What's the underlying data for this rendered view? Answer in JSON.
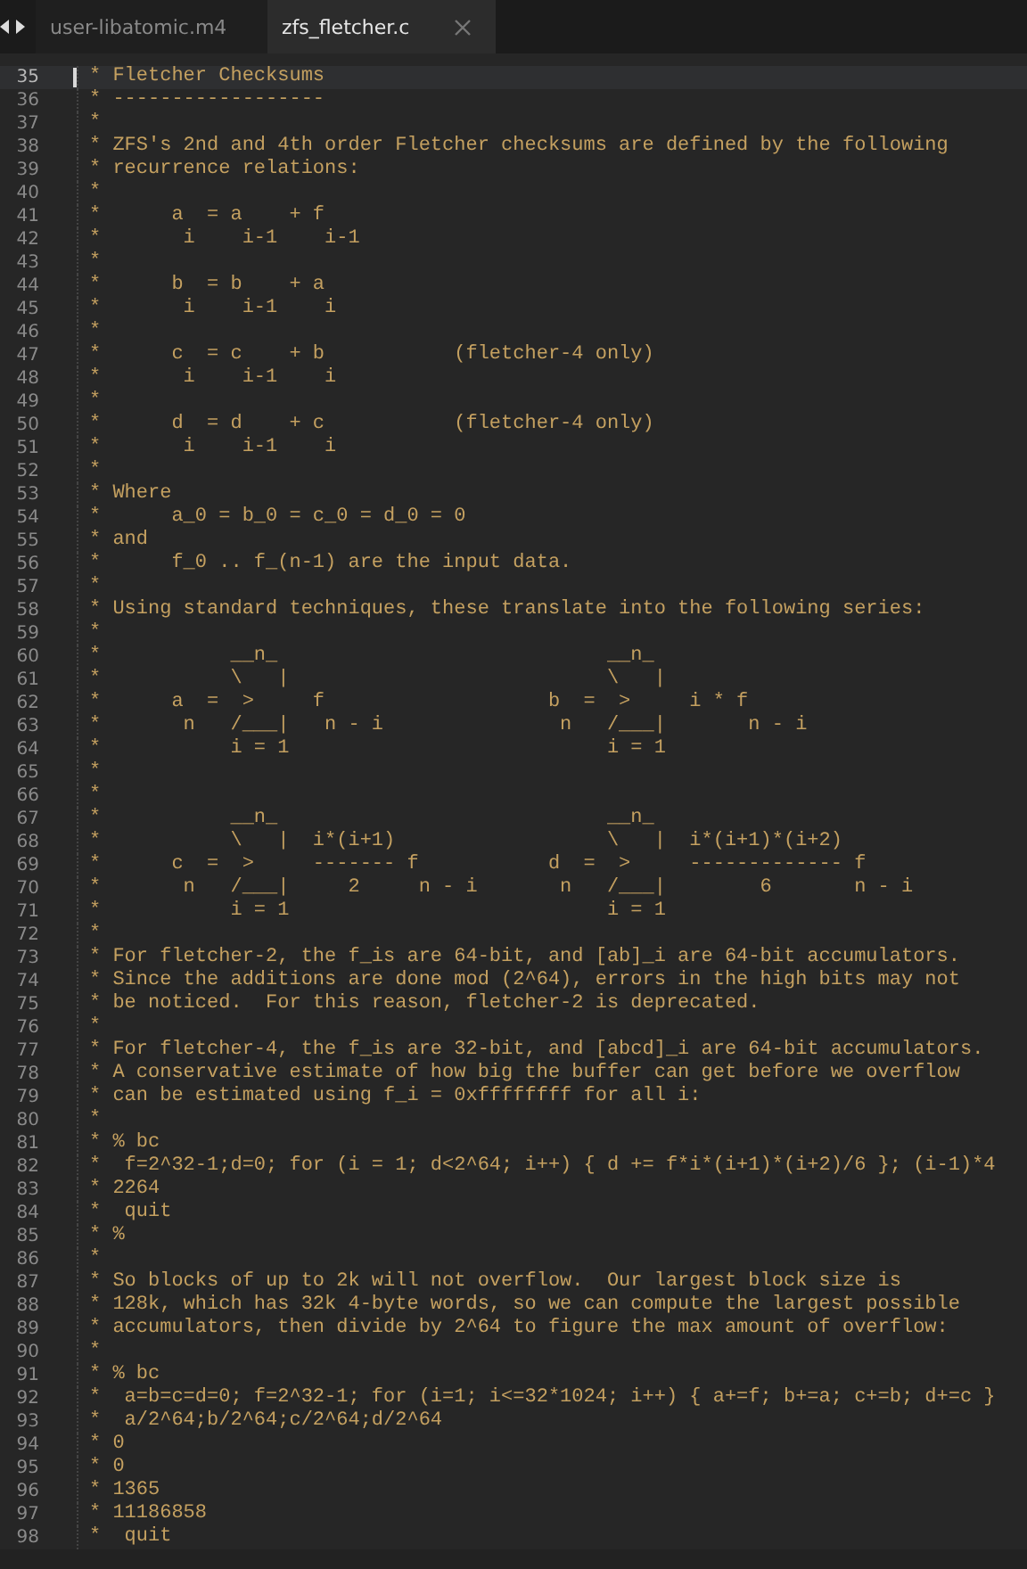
{
  "tabs": [
    {
      "label": "user-libatomic.m4",
      "selected": false
    },
    {
      "label": "zfs_fletcher.c",
      "selected": true
    }
  ],
  "editor": {
    "lines": [
      {
        "number": "35",
        "text": "* Fletcher Checksums",
        "current": true
      },
      {
        "number": "36",
        "text": "* ------------------",
        "current": false
      },
      {
        "number": "37",
        "text": "*",
        "current": false
      },
      {
        "number": "38",
        "text": "* ZFS's 2nd and 4th order Fletcher checksums are defined by the following",
        "current": false
      },
      {
        "number": "39",
        "text": "* recurrence relations:",
        "current": false
      },
      {
        "number": "40",
        "text": "*",
        "current": false
      },
      {
        "number": "41",
        "text": "*      a  = a    + f",
        "current": false
      },
      {
        "number": "42",
        "text": "*       i    i-1    i-1",
        "current": false
      },
      {
        "number": "43",
        "text": "*",
        "current": false
      },
      {
        "number": "44",
        "text": "*      b  = b    + a",
        "current": false
      },
      {
        "number": "45",
        "text": "*       i    i-1    i",
        "current": false
      },
      {
        "number": "46",
        "text": "*",
        "current": false
      },
      {
        "number": "47",
        "text": "*      c  = c    + b           (fletcher-4 only)",
        "current": false
      },
      {
        "number": "48",
        "text": "*       i    i-1    i",
        "current": false
      },
      {
        "number": "49",
        "text": "*",
        "current": false
      },
      {
        "number": "50",
        "text": "*      d  = d    + c           (fletcher-4 only)",
        "current": false
      },
      {
        "number": "51",
        "text": "*       i    i-1    i",
        "current": false
      },
      {
        "number": "52",
        "text": "*",
        "current": false
      },
      {
        "number": "53",
        "text": "* Where",
        "current": false
      },
      {
        "number": "54",
        "text": "*      a_0 = b_0 = c_0 = d_0 = 0",
        "current": false
      },
      {
        "number": "55",
        "text": "* and",
        "current": false
      },
      {
        "number": "56",
        "text": "*      f_0 .. f_(n-1) are the input data.",
        "current": false
      },
      {
        "number": "57",
        "text": "*",
        "current": false
      },
      {
        "number": "58",
        "text": "* Using standard techniques, these translate into the following series:",
        "current": false
      },
      {
        "number": "59",
        "text": "*",
        "current": false
      },
      {
        "number": "60",
        "text": "*           __n_                            __n_",
        "current": false
      },
      {
        "number": "61",
        "text": "*           \\   |                           \\   |",
        "current": false
      },
      {
        "number": "62",
        "text": "*      a  =  >     f                   b  =  >     i * f",
        "current": false
      },
      {
        "number": "63",
        "text": "*       n   /___|   n - i               n   /___|       n - i",
        "current": false
      },
      {
        "number": "64",
        "text": "*           i = 1                           i = 1",
        "current": false
      },
      {
        "number": "65",
        "text": "*",
        "current": false
      },
      {
        "number": "66",
        "text": "*",
        "current": false
      },
      {
        "number": "67",
        "text": "*           __n_                            __n_",
        "current": false
      },
      {
        "number": "68",
        "text": "*           \\   |  i*(i+1)                  \\   |  i*(i+1)*(i+2)",
        "current": false
      },
      {
        "number": "69",
        "text": "*      c  =  >     ------- f           d  =  >     ------------- f",
        "current": false
      },
      {
        "number": "70",
        "text": "*       n   /___|     2     n - i       n   /___|        6       n - i",
        "current": false
      },
      {
        "number": "71",
        "text": "*           i = 1                           i = 1",
        "current": false
      },
      {
        "number": "72",
        "text": "*",
        "current": false
      },
      {
        "number": "73",
        "text": "* For fletcher-2, the f_is are 64-bit, and [ab]_i are 64-bit accumulators.",
        "current": false
      },
      {
        "number": "74",
        "text": "* Since the additions are done mod (2^64), errors in the high bits may not",
        "current": false
      },
      {
        "number": "75",
        "text": "* be noticed.  For this reason, fletcher-2 is deprecated.",
        "current": false
      },
      {
        "number": "76",
        "text": "*",
        "current": false
      },
      {
        "number": "77",
        "text": "* For fletcher-4, the f_is are 32-bit, and [abcd]_i are 64-bit accumulators.",
        "current": false
      },
      {
        "number": "78",
        "text": "* A conservative estimate of how big the buffer can get before we overflow",
        "current": false
      },
      {
        "number": "79",
        "text": "* can be estimated using f_i = 0xffffffff for all i:",
        "current": false
      },
      {
        "number": "80",
        "text": "*",
        "current": false
      },
      {
        "number": "81",
        "text": "* % bc",
        "current": false
      },
      {
        "number": "82",
        "text": "*  f=2^32-1;d=0; for (i = 1; d<2^64; i++) { d += f*i*(i+1)*(i+2)/6 }; (i-1)*4",
        "current": false
      },
      {
        "number": "83",
        "text": "* 2264",
        "current": false
      },
      {
        "number": "84",
        "text": "*  quit",
        "current": false
      },
      {
        "number": "85",
        "text": "* %",
        "current": false
      },
      {
        "number": "86",
        "text": "*",
        "current": false
      },
      {
        "number": "87",
        "text": "* So blocks of up to 2k will not overflow.  Our largest block size is",
        "current": false
      },
      {
        "number": "88",
        "text": "* 128k, which has 32k 4-byte words, so we can compute the largest possible",
        "current": false
      },
      {
        "number": "89",
        "text": "* accumulators, then divide by 2^64 to figure the max amount of overflow:",
        "current": false
      },
      {
        "number": "90",
        "text": "*",
        "current": false
      },
      {
        "number": "91",
        "text": "* % bc",
        "current": false
      },
      {
        "number": "92",
        "text": "*  a=b=c=d=0; f=2^32-1; for (i=1; i<=32*1024; i++) { a+=f; b+=a; c+=b; d+=c }",
        "current": false
      },
      {
        "number": "93",
        "text": "*  a/2^64;b/2^64;c/2^64;d/2^64",
        "current": false
      },
      {
        "number": "94",
        "text": "* 0",
        "current": false
      },
      {
        "number": "95",
        "text": "* 0",
        "current": false
      },
      {
        "number": "96",
        "text": "* 1365",
        "current": false
      },
      {
        "number": "97",
        "text": "* 11186858",
        "current": false
      },
      {
        "number": "98",
        "text": "*  quit",
        "current": false
      }
    ]
  }
}
